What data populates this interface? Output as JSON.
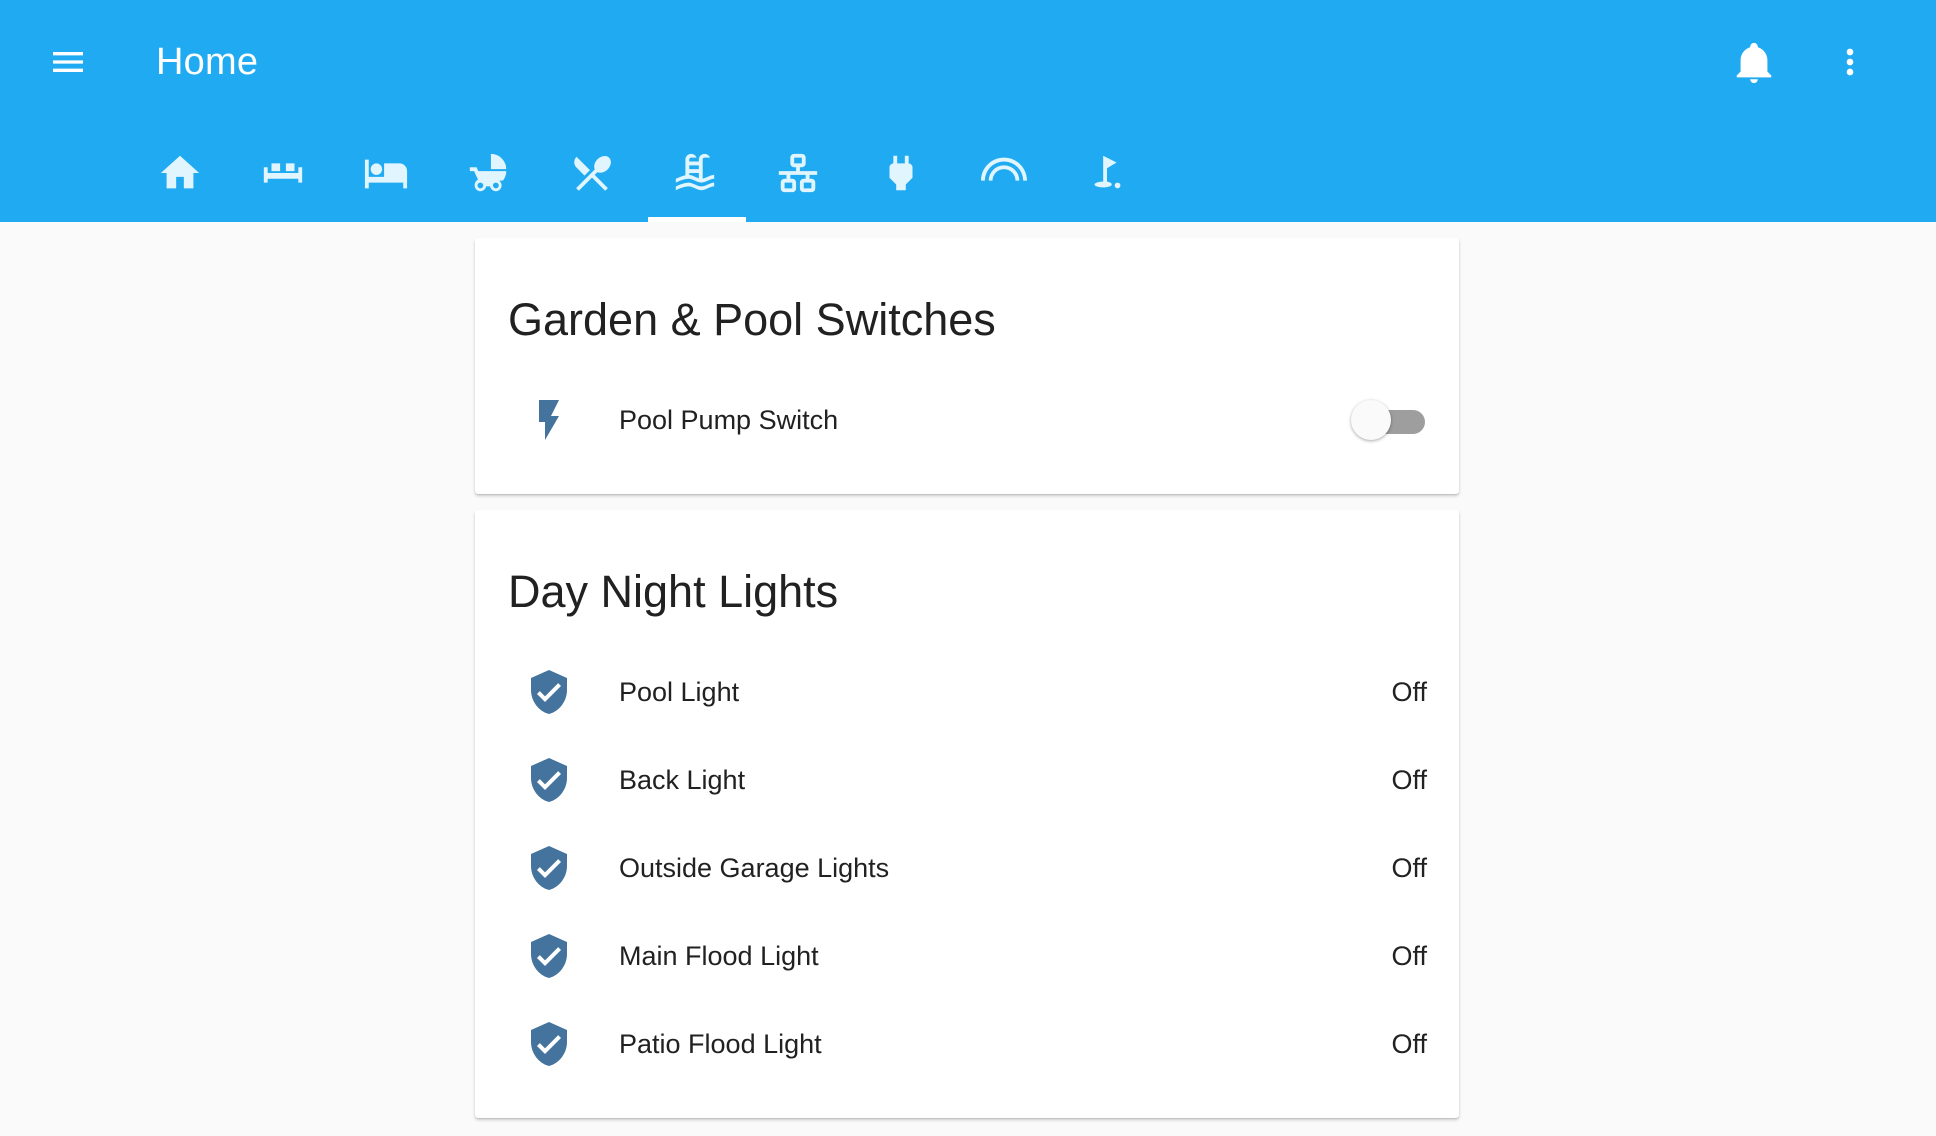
{
  "header": {
    "title": "Home",
    "background": "#1faaf1",
    "menu_icon": "menu-icon",
    "notifications_icon": "bell-icon",
    "more_icon": "more-vert-icon"
  },
  "tabs": [
    {
      "icon": "home-icon",
      "active": false
    },
    {
      "icon": "sofa-icon",
      "active": false
    },
    {
      "icon": "bed-icon",
      "active": false
    },
    {
      "icon": "baby-carriage-icon",
      "active": false
    },
    {
      "icon": "silverware-icon",
      "active": false
    },
    {
      "icon": "pool-icon",
      "active": true
    },
    {
      "icon": "lan-icon",
      "active": false
    },
    {
      "icon": "power-plug-icon",
      "active": false
    },
    {
      "icon": "rainbow-icon",
      "active": false
    },
    {
      "icon": "golf-icon",
      "active": false
    }
  ],
  "cards": [
    {
      "title": "Garden & Pool Switches",
      "entities": [
        {
          "name": "Pool Pump Switch",
          "icon": "flash-icon",
          "toggle_on": false
        }
      ]
    },
    {
      "title": "Day Night Lights",
      "entities": [
        {
          "name": "Pool Light",
          "icon": "shield-check-icon",
          "state": "Off"
        },
        {
          "name": "Back Light",
          "icon": "shield-check-icon",
          "state": "Off"
        },
        {
          "name": "Outside Garage Lights",
          "icon": "shield-check-icon",
          "state": "Off"
        },
        {
          "name": "Main Flood Light",
          "icon": "shield-check-icon",
          "state": "Off"
        },
        {
          "name": "Patio Flood Light",
          "icon": "shield-check-icon",
          "state": "Off"
        }
      ]
    }
  ],
  "colors": {
    "icon": "#44739e",
    "tab_icon": "#e1f5fe"
  }
}
